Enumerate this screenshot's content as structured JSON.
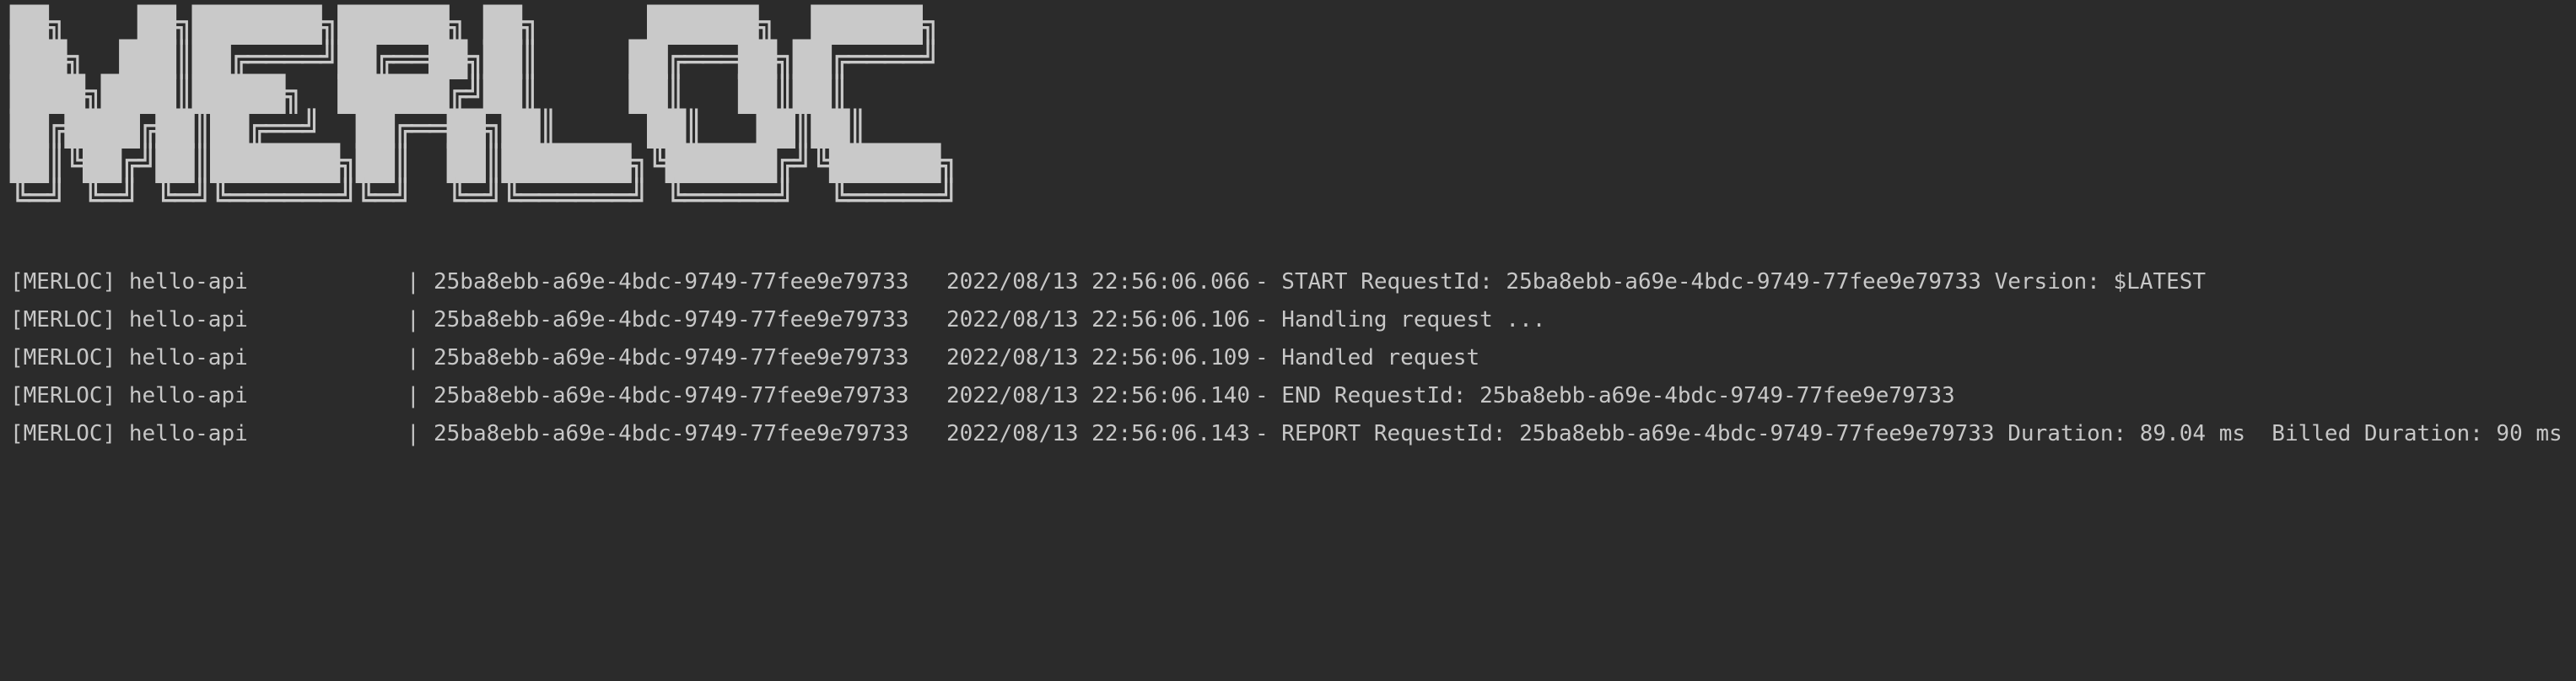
{
  "terminal": {
    "banner_art": "██╗    ██╗███████╗██████╗ ██╗      ██████╗  ██████╗\n███╗  ███║██╔════╝██╔══██╗██║     ██╔═══██╗██╔════╝\n████╗████║█████╗  ██████╔╝██║     ██║   ██║██║     \n██╔████╔██║██╔══╝  ██╔══██╗██║     ██║   ██║██║     \n██║╚██╔╝██║███████╗██║  ██║███████╗╚██████╔╝╚██████╗\n╚═╝ ╚═╝ ╚═╝╚══════╝╚═╝  ╚═╝╚══════╝ ╚═════╝  ╚═════╝",
    "log_lines": [
      {
        "prefix": "[MERLOC] hello-api",
        "separator": "|",
        "request_id": "25ba8ebb-a69e-4bdc-9749-77fee9e79733",
        "timestamp": "2022/08/13 22:56:06.066",
        "message": "- START RequestId: 25ba8ebb-a69e-4bdc-9749-77fee9e79733 Version: $LATEST"
      },
      {
        "prefix": "[MERLOC] hello-api",
        "separator": "|",
        "request_id": "25ba8ebb-a69e-4bdc-9749-77fee9e79733",
        "timestamp": "2022/08/13 22:56:06.106",
        "message": "- Handling request ..."
      },
      {
        "prefix": "[MERLOC] hello-api",
        "separator": "|",
        "request_id": "25ba8ebb-a69e-4bdc-9749-77fee9e79733",
        "timestamp": "2022/08/13 22:56:06.109",
        "message": "- Handled request"
      },
      {
        "prefix": "[MERLOC] hello-api",
        "separator": "|",
        "request_id": "25ba8ebb-a69e-4bdc-9749-77fee9e79733",
        "timestamp": "2022/08/13 22:56:06.140",
        "message": "- END RequestId: 25ba8ebb-a69e-4bdc-9749-77fee9e79733"
      },
      {
        "prefix": "[MERLOC] hello-api",
        "separator": "|",
        "request_id": "25ba8ebb-a69e-4bdc-9749-77fee9e79733",
        "timestamp": "2022/08/13 22:56:06.143",
        "message": "- REPORT RequestId: 25ba8ebb-a69e-4bdc-9749-77fee9e79733 Duration: 89.04 ms  Billed Duration: 90 ms"
      }
    ]
  },
  "colors": {
    "background": "#2b2b2b",
    "text": "#c7c7c7",
    "banner": "#c9c9c9"
  }
}
